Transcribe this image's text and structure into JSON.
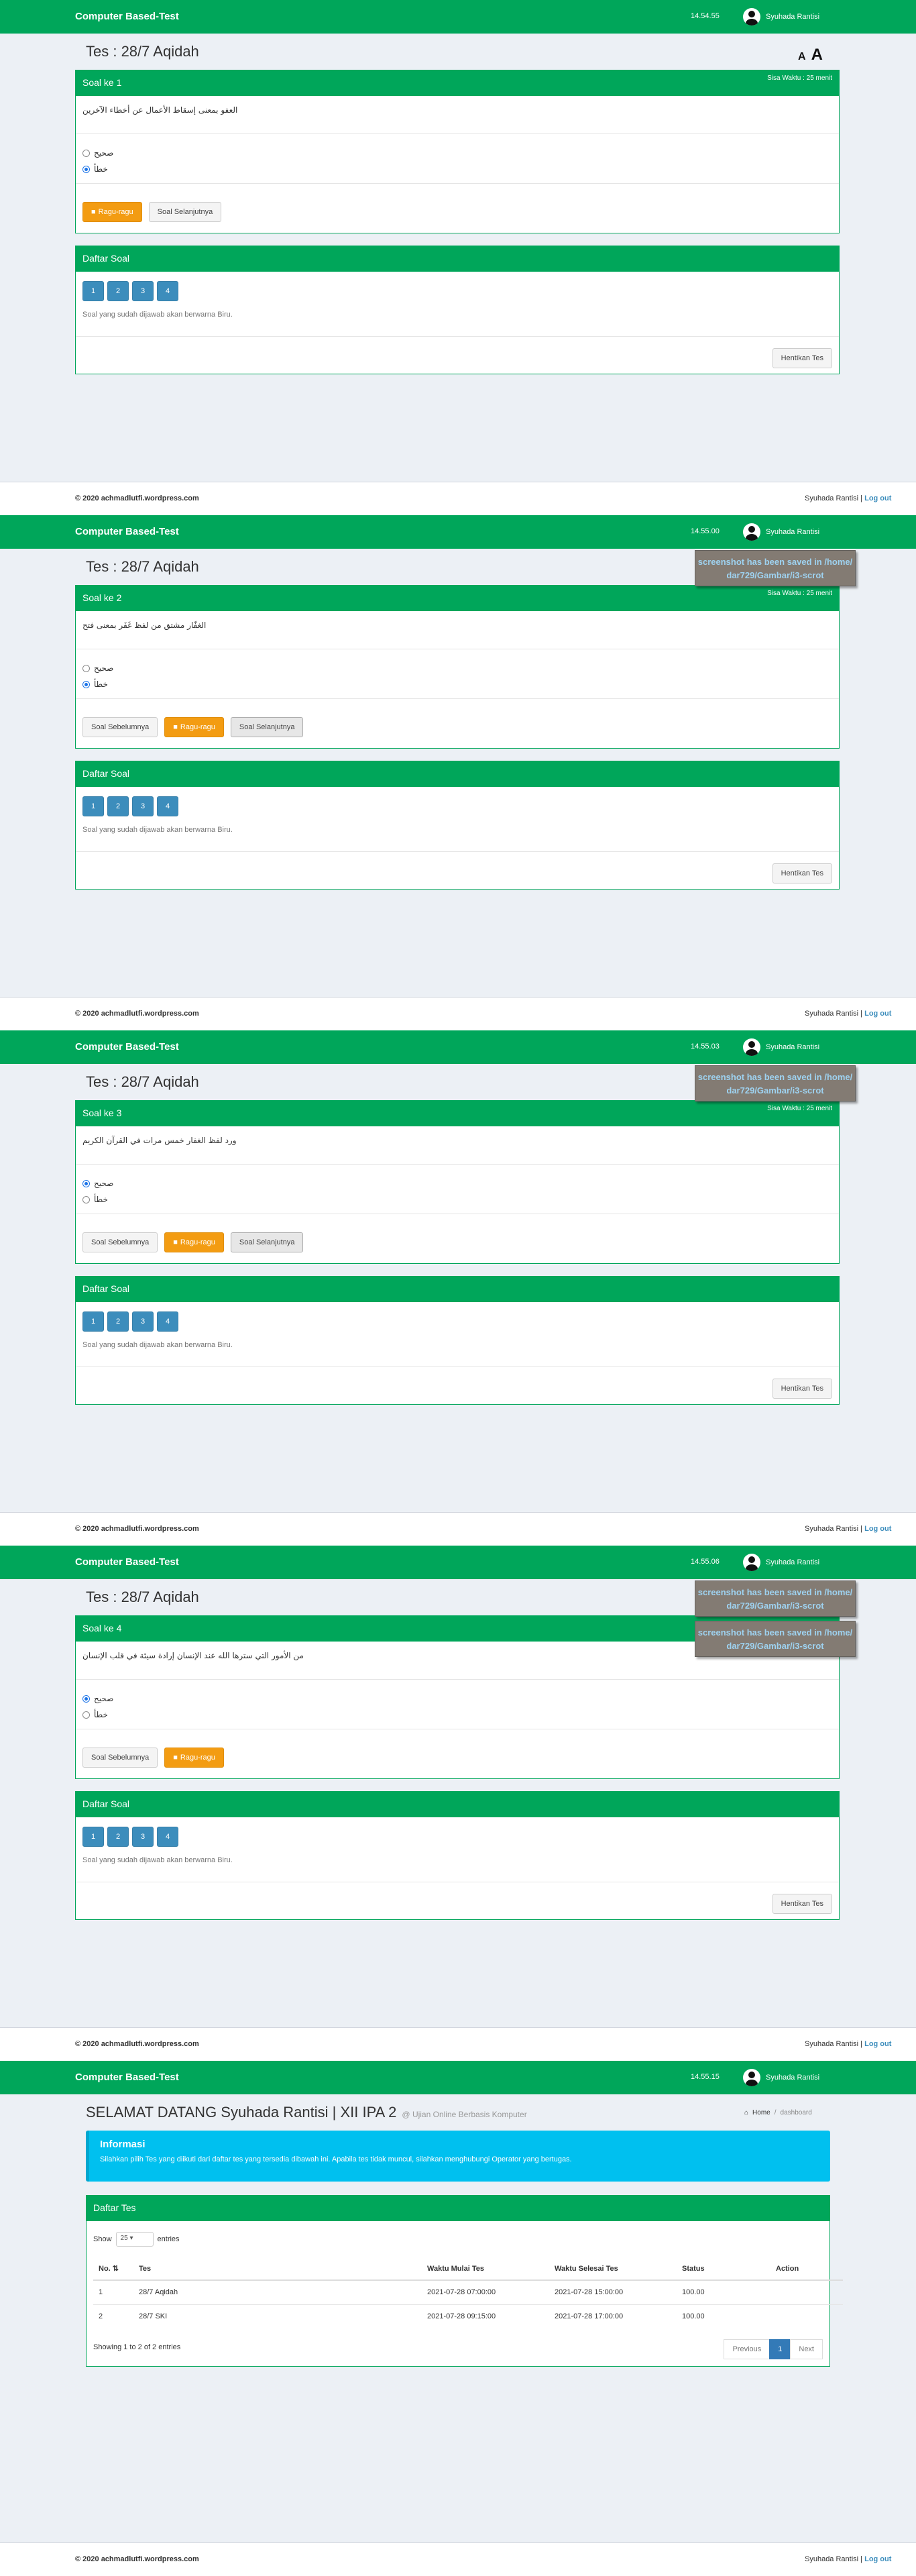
{
  "app": {
    "brand": "Computer Based-Test",
    "user": "Syuhada Rantisi",
    "exam_title": "Tes : 28/7 Aqidah",
    "font_small": "A",
    "font_large": "A"
  },
  "timer_label": "Sisa Waktu : 25 menit",
  "daftar": {
    "title": "Daftar Soal",
    "numbers": [
      "1",
      "2",
      "3",
      "4"
    ],
    "note": "Soal yang sudah dijawab akan berwarna Biru.",
    "stop": "Hentikan Tes"
  },
  "buttons": {
    "prev": "Soal Sebelumnya",
    "doubt": "Ragu-ragu",
    "next": "Soal Selanjutnya"
  },
  "options": {
    "a": "صحيح",
    "b": "خطأ"
  },
  "footer": {
    "copyright": "© 2020 achmadlutfi.wordpress.com",
    "user": "Syuhada Rantisi",
    "sep": "|",
    "logout": "Log out"
  },
  "notification": "screenshot has been saved in /home/ dar729/Gambar/i3-scrot",
  "icons": {
    "doubt": "doubt-icon",
    "home": "home-icon",
    "sort": "sort-icon",
    "user": "user-avatar"
  },
  "colors": {
    "header": "#00a65a",
    "accent": "#3c8dbc",
    "warning": "#f39c12",
    "callout": "#00c0ef"
  },
  "screens": [
    {
      "time": "14.54.55",
      "heading": "Soal ke 1",
      "question": "العفو بمعنى إسقاط الأعمال عن أخطاء الآخرين",
      "selected": "b"
    },
    {
      "time": "14.55.00",
      "heading": "Soal ke 2",
      "question": "الغفّار مشتق من لفظ غَفَر بمعنى فتح",
      "selected": "b"
    },
    {
      "time": "14.55.03",
      "heading": "Soal ke 3",
      "question": "ورد لفظ الغفار خمس مرات في القرآن الكريم",
      "selected": "a"
    },
    {
      "time": "14.55.06",
      "heading": "Soal ke 4",
      "question": "من الأمور التي سترها الله عند الإنسان إرادة سيئة في قلب الإنسان",
      "selected": "a"
    }
  ],
  "dashboard": {
    "time": "14.55.15",
    "welcome": "SELAMAT DATANG Syuhada Rantisi | XII IPA 2",
    "subtitle": "@ Ujian Online Berbasis Komputer",
    "breadcrumb": {
      "home": "Home",
      "sep": "/",
      "current": "dashboard"
    },
    "callout_title": "Informasi",
    "callout_text": "Silahkan pilih Tes yang diikuti dari daftar tes yang tersedia dibawah ini. Apabila tes tidak muncul, silahkan menghubungi Operator yang bertugas.",
    "box_title": "Daftar Tes",
    "show": "Show",
    "entries_value": "25",
    "entries": "entries",
    "columns": [
      "No.",
      "Tes",
      "Waktu Mulai Tes",
      "Waktu Selesai Tes",
      "Status",
      "Action"
    ],
    "rows": [
      [
        "1",
        "28/7 Aqidah",
        "2021-07-28 07:00:00",
        "2021-07-28 15:00:00",
        "100.00",
        ""
      ],
      [
        "2",
        "28/7 SKI",
        "2021-07-28 09:15:00",
        "2021-07-28 17:00:00",
        "100.00",
        ""
      ]
    ],
    "info": "Showing 1 to 2 of 2 entries",
    "pager": {
      "prev": "Previous",
      "page": "1",
      "next": "Next"
    }
  }
}
